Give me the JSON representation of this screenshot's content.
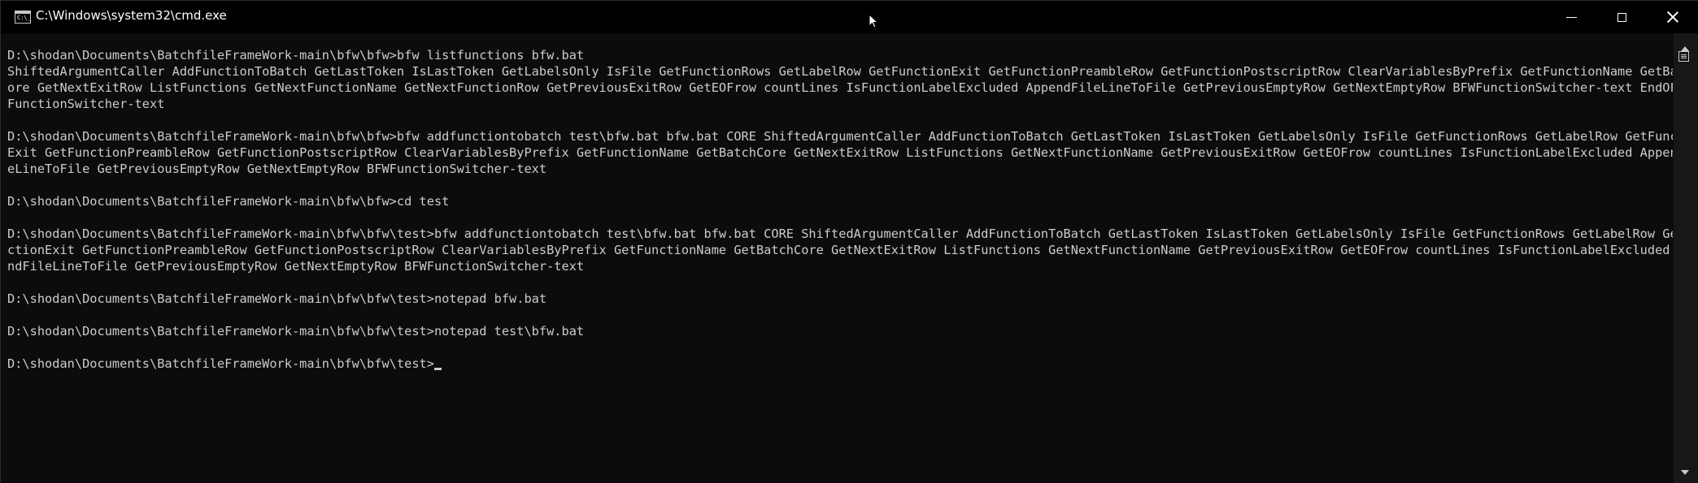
{
  "window": {
    "title": "C:\\Windows\\system32\\cmd.exe",
    "icon_text": "C:\\_"
  },
  "console": {
    "lines": [
      "D:\\shodan\\Documents\\BatchfileFrameWork-main\\bfw\\bfw>bfw listfunctions bfw.bat",
      "ShiftedArgumentCaller AddFunctionToBatch GetLastToken IsLastToken GetLabelsOnly IsFile GetFunctionRows GetLabelRow GetFunctionExit GetFunctionPreambleRow GetFunctionPostscriptRow ClearVariablesByPrefix GetFunctionName GetBatchC",
      "ore GetNextExitRow ListFunctions GetNextFunctionName GetNextFunctionRow GetPreviousExitRow GetEOFrow countLines IsFunctionLabelExcluded AppendFileLineToFile GetPreviousEmptyRow GetNextEmptyRow BFWFunctionSwitcher-text EndOF_BFW",
      "FunctionSwitcher-text",
      "",
      "D:\\shodan\\Documents\\BatchfileFrameWork-main\\bfw\\bfw>bfw addfunctiontobatch test\\bfw.bat bfw.bat CORE ShiftedArgumentCaller AddFunctionToBatch GetLastToken IsLastToken GetLabelsOnly IsFile GetFunctionRows GetLabelRow GetFunction",
      "Exit GetFunctionPreambleRow GetFunctionPostscriptRow ClearVariablesByPrefix GetFunctionName GetBatchCore GetNextExitRow ListFunctions GetNextFunctionName GetPreviousExitRow GetEOFrow countLines IsFunctionLabelExcluded AppendFil",
      "eLineToFile GetPreviousEmptyRow GetNextEmptyRow BFWFunctionSwitcher-text",
      "",
      "D:\\shodan\\Documents\\BatchfileFrameWork-main\\bfw\\bfw>cd test",
      "",
      "D:\\shodan\\Documents\\BatchfileFrameWork-main\\bfw\\bfw\\test>bfw addfunctiontobatch test\\bfw.bat bfw.bat CORE ShiftedArgumentCaller AddFunctionToBatch GetLastToken IsLastToken GetLabelsOnly IsFile GetFunctionRows GetLabelRow GetFun",
      "ctionExit GetFunctionPreambleRow GetFunctionPostscriptRow ClearVariablesByPrefix GetFunctionName GetBatchCore GetNextExitRow ListFunctions GetNextFunctionName GetPreviousExitRow GetEOFrow countLines IsFunctionLabelExcluded Appe",
      "ndFileLineToFile GetPreviousEmptyRow GetNextEmptyRow BFWFunctionSwitcher-text",
      "",
      "D:\\shodan\\Documents\\BatchfileFrameWork-main\\bfw\\bfw\\test>notepad bfw.bat",
      "",
      "D:\\shodan\\Documents\\BatchfileFrameWork-main\\bfw\\bfw\\test>notepad test\\bfw.bat",
      "",
      "D:\\shodan\\Documents\\BatchfileFrameWork-main\\bfw\\bfw\\test>"
    ]
  },
  "colors": {
    "background": "#0c0c0c",
    "titlebar": "#000000",
    "text": "#cccccc"
  },
  "icons": {
    "minimize": "minimize-icon",
    "maximize": "maximize-icon",
    "close": "close-icon",
    "scroll_up": "chevron-up-icon",
    "scroll_down": "chevron-down-icon"
  }
}
